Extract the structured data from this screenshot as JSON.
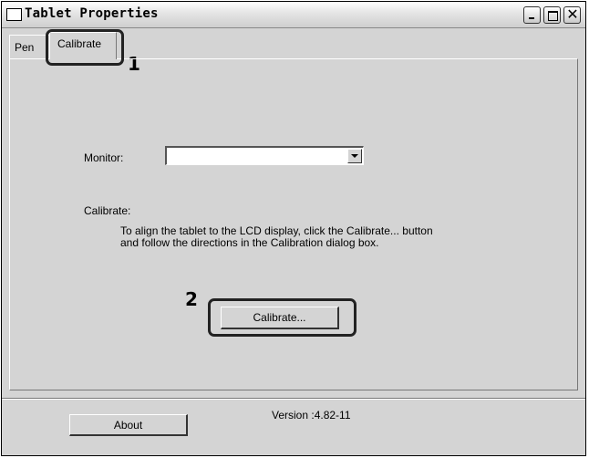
{
  "window": {
    "title": "Tablet Properties",
    "icons": {
      "minimize": "minimize-icon",
      "maximize": "maximize-icon",
      "close": "close-icon"
    },
    "close_glyph": "✕"
  },
  "tabs": [
    {
      "label": "Pen"
    },
    {
      "label": "Calibrate"
    }
  ],
  "callouts": {
    "one": "1",
    "two": "2"
  },
  "calibrate_panel": {
    "monitor_label": "Monitor:",
    "monitor_value": "",
    "section_label": "Calibrate:",
    "instructions_line1": "To align the tablet to the LCD display, click the Calibrate... button",
    "instructions_line2": "and follow the directions in the Calibration dialog box.",
    "calibrate_button": "Calibrate..."
  },
  "footer": {
    "about_button": "About",
    "version": "Version :4.82-11"
  }
}
